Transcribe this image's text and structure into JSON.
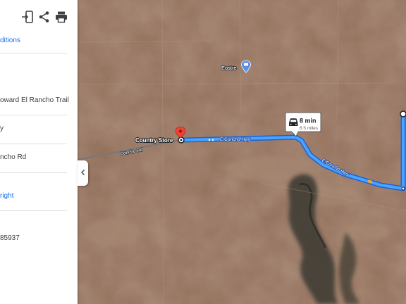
{
  "panel": {
    "row1": "ditions",
    "row2": "oward El Rancho Trail",
    "row3": "y",
    "row4": "ncho Rd",
    "row5": "right",
    "row6": "85937"
  },
  "map": {
    "labels": {
      "concho_rd": "Concho Rd",
      "e_concho_hwy_1": "E Concho Hwy",
      "e_concho_hwy_2": "E Concho Hwy",
      "country_store": "Country Store",
      "eostre": "Eostre"
    },
    "callout": {
      "time": "8 min",
      "distance": "6.5 miles"
    },
    "colors": {
      "route": "#4285f4",
      "route_outline": "#1a63d4",
      "pin": "#ea4335"
    },
    "icons": [
      "car-icon",
      "place-pin-icon",
      "poi-icon"
    ]
  },
  "toolbar": {
    "icons": [
      "send-to-device-icon",
      "share-icon",
      "print-icon"
    ]
  }
}
